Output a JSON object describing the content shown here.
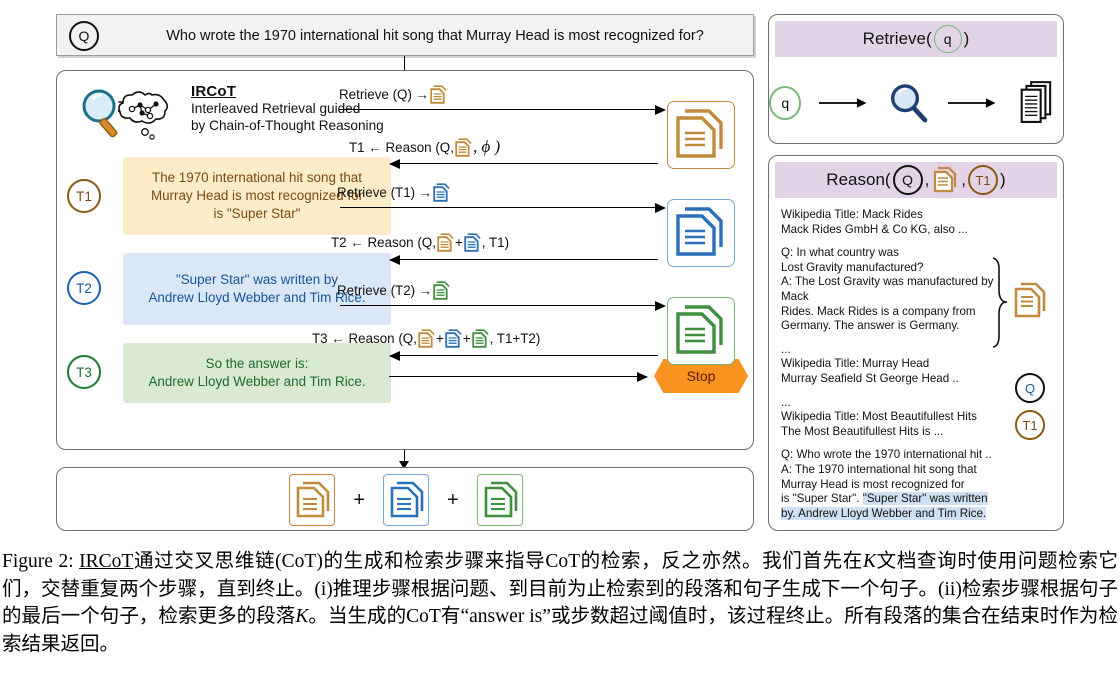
{
  "question": {
    "badge": "Q",
    "text": "Who wrote the 1970 international hit song that Murray Head is most recognized for?"
  },
  "ircot": {
    "title": "IRCoT",
    "subtitle_line1": "Interleaved Retrieval guided",
    "subtitle_line2": "by Chain-of-Thought Reasoning"
  },
  "thoughts": [
    {
      "badge": "T1",
      "line1": "The 1970 international hit song that",
      "line2": "Murray Head is most recognized for",
      "line3": "is \"Super Star\"",
      "color": "#7b4a12",
      "bg": "#fdecc8"
    },
    {
      "badge": "T2",
      "line1": "\"Super Star\" was written by",
      "line2": "Andrew Lloyd Webber and Tim Rice.",
      "line3": "",
      "color": "#15559c",
      "bg": "#dbe6f7"
    },
    {
      "badge": "T3",
      "line1": "So the answer is:",
      "line2": "Andrew Lloyd Webber and Tim Rice.",
      "line3": "",
      "color": "#1e6b2b",
      "bg": "#d9e9d2"
    }
  ],
  "arrows": [
    {
      "name": "retrieve-q",
      "label_pre": "Retrieve (Q) →",
      "label_post": "",
      "direction": "right"
    },
    {
      "name": "reason-t1",
      "label_pre": "T1 ← Reason (Q,",
      "label_post": ",  ϕ  )",
      "direction": "left"
    },
    {
      "name": "retrieve-t1",
      "label_pre": "Retrieve (T1) →",
      "label_post": "",
      "direction": "right"
    },
    {
      "name": "reason-t2",
      "label_pre": "T2 ← Reason (Q,",
      "label_post": ", T1)",
      "direction": "left"
    },
    {
      "name": "retrieve-t2",
      "label_pre": "Retrieve (T2) →",
      "label_post": "",
      "direction": "right"
    },
    {
      "name": "reason-t3",
      "label_pre": "T3 ← Reason (Q,",
      "label_post": ", T1+T2)",
      "direction": "left"
    },
    {
      "name": "stop-arrow",
      "label_pre": "",
      "label_post": "",
      "direction": "right"
    }
  ],
  "stop": {
    "label": "Stop",
    "color": "#f7931e"
  },
  "bottom": {
    "plus": "+"
  },
  "retrieve_panel": {
    "header_pre": "Retrieve(",
    "header_badge": "q",
    "header_post": ")",
    "input_badge": "q",
    "search_icon": "magnifier-icon",
    "output_icon": "document-stack-icon"
  },
  "reason_panel": {
    "header_pre": "Reason(",
    "header_badge_q": "Q",
    "header_badge_t1": "T1",
    "header_sep": ",",
    "header_post": ")",
    "paragraphs": [
      "Wikipedia Title: Mack Rides\nMack Rides GmbH & Co KG, also ...",
      "Q: In what country was\nLost Gravity manufactured?\nA: The Lost Gravity was manufactured by Mack\nRides. Mack Rides is a company from\nGermany. The answer is Germany.",
      "...\nWikipedia Title: Murray Head\nMurray Seafield St George Head ..",
      "...\nWikipedia Title: Most Beautifullest Hits\nThe Most Beautifullest Hits is ..."
    ],
    "qa_question": "Q: Who wrote the 1970 international hit ..",
    "qa_answer_plain_1": "A: The 1970 international hit song that",
    "qa_answer_plain_2": "Murray Head is most recognized for",
    "qa_answer_plain_3": "is \"Super Star\". ",
    "qa_answer_highlight_1": "\"Super Star\" was written",
    "qa_answer_highlight_2": "by. Andrew Lloyd Webber and Tim Rice.",
    "side_badge_q": "Q",
    "side_badge_t1": "T1"
  },
  "caption": {
    "prefix": "Figure 2: ",
    "underlined": "IRCoT",
    "body_1": "通过交叉思维链(CoT)的生成和检索步骤来指导CoT的检索，反之亦然。我们首先在",
    "italic_K_1": "K",
    "body_2": "文档查询时使用问题检索它们，交替重复两个步骤，直到终止。(i)推理步骤根据问题、到目前为止检索到的段落和句子生成下一个句子。(ii)检索步骤根据句子的最后一个句子，检索更多的段落",
    "italic_K_2": "K",
    "body_3": "。当生成的CoT有“answer is”或步数超过阈值时，该过程终止。所有段落的集合在结束时作为检索结果返回。"
  },
  "colors": {
    "gold": "#c08b3e",
    "blue": "#2a70b8",
    "green": "#3f8f3f",
    "purple_bar": "#e2d3e6",
    "highlight": "#cfe0f2"
  }
}
